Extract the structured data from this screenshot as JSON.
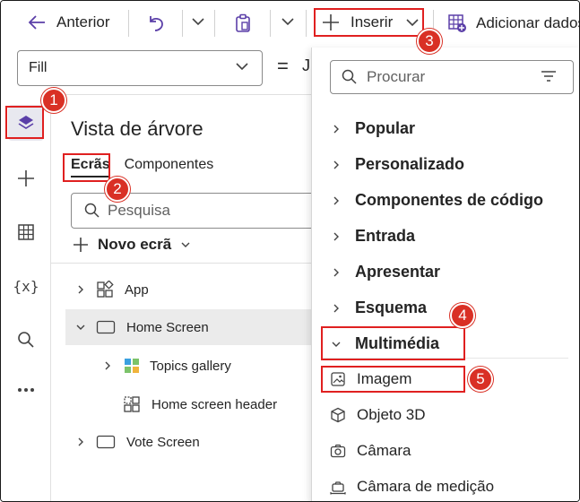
{
  "toolbar": {
    "back_label": "Anterior",
    "insert_label": "Inserir",
    "add_data_label": "Adicionar dados"
  },
  "formula": {
    "property": "Fill",
    "equals": "=",
    "text": "J"
  },
  "tree": {
    "title": "Vista de árvore",
    "tab_screens": "Ecrãs",
    "tab_components": "Componentes",
    "search_placeholder": "Pesquisa",
    "new_screen_label": "Novo ecrã",
    "nodes": [
      {
        "label": "App"
      },
      {
        "label": "Home Screen"
      },
      {
        "label": "Topics gallery"
      },
      {
        "label": "Home screen header"
      },
      {
        "label": "Vote Screen"
      }
    ]
  },
  "flyout": {
    "search_placeholder": "Procurar",
    "categories": [
      {
        "label": "Popular"
      },
      {
        "label": "Personalizado"
      },
      {
        "label": "Componentes de código"
      },
      {
        "label": "Entrada"
      },
      {
        "label": "Apresentar"
      },
      {
        "label": "Esquema"
      },
      {
        "label": "Multimédia"
      }
    ],
    "media_items": [
      {
        "label": "Imagem"
      },
      {
        "label": "Objeto 3D"
      },
      {
        "label": "Câmara"
      },
      {
        "label": "Câmara de medição"
      }
    ]
  },
  "callouts": [
    "1",
    "2",
    "3",
    "4",
    "5"
  ],
  "colors": {
    "callout_red": "#e02020",
    "brand_purple": "#5b3fa8"
  }
}
